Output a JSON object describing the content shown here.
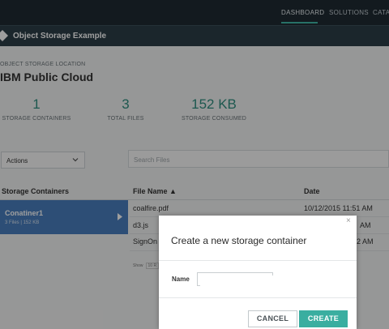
{
  "topnav": {
    "items": [
      "DASHBOARD",
      "SOLUTIONS",
      "CATA"
    ]
  },
  "appbar": {
    "title": "Object Storage Example"
  },
  "location": {
    "label": "OBJECT STORAGE LOCATION",
    "name": "IBM Public Cloud"
  },
  "stats": [
    {
      "value": "1",
      "label": "STORAGE CONTAINERS"
    },
    {
      "value": "3",
      "label": "TOTAL FILES"
    },
    {
      "value": "152 KB",
      "label": "STORAGE CONSUMED"
    }
  ],
  "actions": {
    "label": "Actions"
  },
  "search": {
    "placeholder": "Search Files"
  },
  "containers": {
    "header": "Storage Containers",
    "items": [
      {
        "name": "Conatiner1",
        "meta": "3 Files | 152 KB"
      }
    ]
  },
  "files": {
    "col_name": "File Name ▲",
    "col_date": "Date",
    "rows": [
      {
        "name": "coalfire.pdf",
        "date": "10/12/2015 11:51 AM"
      },
      {
        "name": "d3.js",
        "date": "AM"
      },
      {
        "name": "SignOn",
        "date": "2 AM"
      }
    ],
    "show_label": "Show",
    "show_value": "10 R"
  },
  "modal": {
    "close": "×",
    "title": "Create a new storage container",
    "name_label": "Name",
    "name_value": "",
    "cancel": "CANCEL",
    "create": "CREATE"
  },
  "colors": {
    "accent": "#3aaea0",
    "selected": "#4a7fbf",
    "nav": "#1f2b33"
  }
}
